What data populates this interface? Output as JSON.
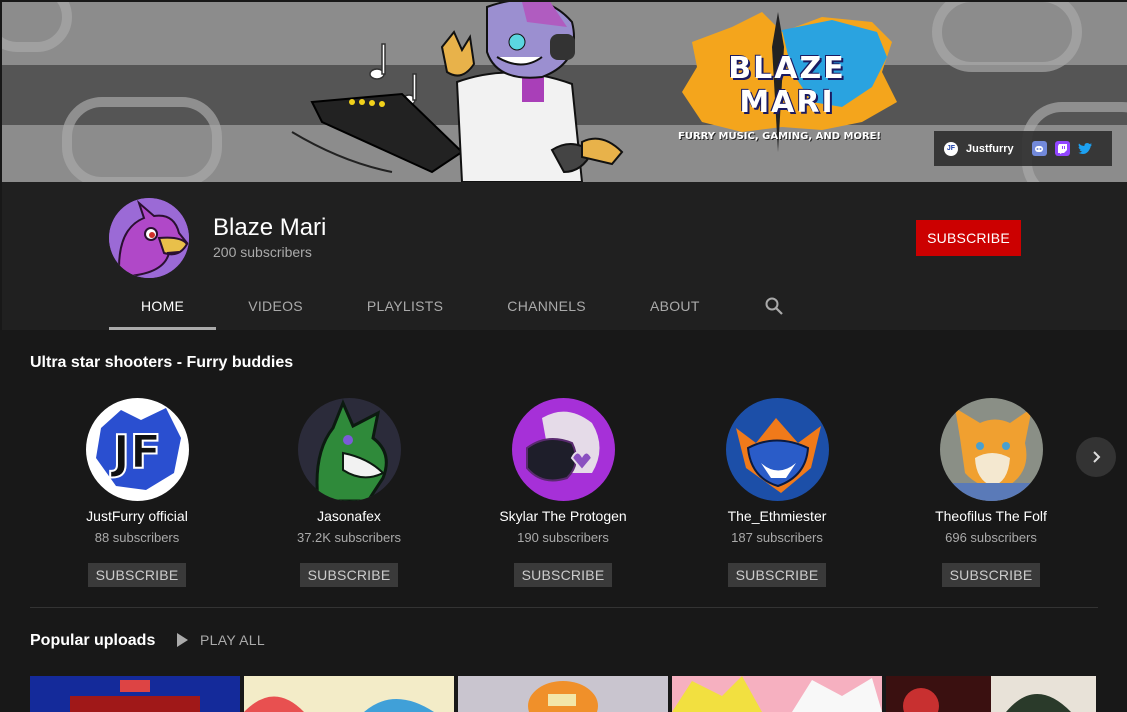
{
  "banner": {
    "logo_title": "BLAZE MARI",
    "logo_tagline": "FURRY MUSIC, GAMING, AND MORE!",
    "links": [
      {
        "label": "Justfurry",
        "icon": "justfurry-icon"
      },
      {
        "label": "",
        "icon": "discord-icon",
        "color": "#7289da"
      },
      {
        "label": "",
        "icon": "twitch-icon",
        "color": "#9146ff"
      },
      {
        "label": "",
        "icon": "twitter-icon",
        "color": "#1da1f2"
      }
    ]
  },
  "channel": {
    "name": "Blaze Mari",
    "subscribers": "200 subscribers",
    "subscribe_label": "SUBSCRIBE",
    "accent": "#cc0000"
  },
  "tabs": [
    {
      "label": "HOME",
      "active": true
    },
    {
      "label": "VIDEOS",
      "active": false
    },
    {
      "label": "PLAYLISTS",
      "active": false
    },
    {
      "label": "CHANNELS",
      "active": false
    },
    {
      "label": "ABOUT",
      "active": false
    }
  ],
  "shelf": {
    "title": "Ultra star shooters - Furry buddies",
    "channels": [
      {
        "name": "JustFurry official",
        "subscribers": "88 subscribers",
        "button": "SUBSCRIBE"
      },
      {
        "name": "Jasonafex",
        "subscribers": "37.2K subscribers",
        "button": "SUBSCRIBE"
      },
      {
        "name": "Skylar The Protogen",
        "subscribers": "190 subscribers",
        "button": "SUBSCRIBE"
      },
      {
        "name": "The_Ethmiester",
        "subscribers": "187 subscribers",
        "button": "SUBSCRIBE"
      },
      {
        "name": "Theofilus The Folf",
        "subscribers": "696 subscribers",
        "button": "SUBSCRIBE"
      }
    ]
  },
  "popular": {
    "title": "Popular uploads",
    "play_all": "PLAY ALL"
  }
}
